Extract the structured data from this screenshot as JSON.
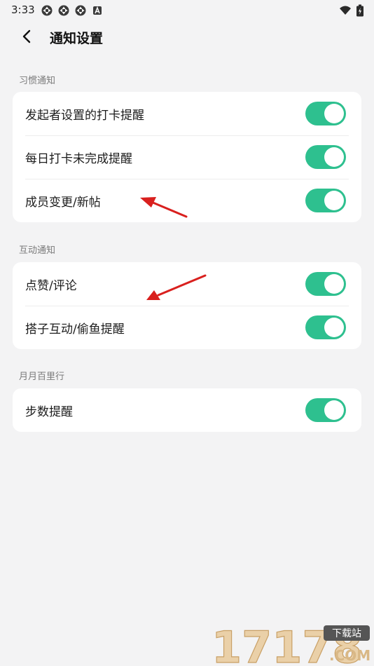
{
  "status_bar": {
    "time": "3:33",
    "icons": [
      "sync-icon",
      "sync-icon",
      "sync-icon",
      "a-badge-icon",
      "wifi-icon",
      "battery-icon"
    ]
  },
  "header": {
    "title": "通知设置",
    "back_icon": "chevron-left-icon"
  },
  "sections": [
    {
      "label": "习惯通知",
      "items": [
        {
          "label": "发起者设置的打卡提醒",
          "enabled": true
        },
        {
          "label": "每日打卡未完成提醒",
          "enabled": true
        },
        {
          "label": "成员变更/新帖",
          "enabled": true
        }
      ]
    },
    {
      "label": "互动通知",
      "items": [
        {
          "label": "点赞/评论",
          "enabled": true
        },
        {
          "label": "搭子互动/偷鱼提醒",
          "enabled": true
        }
      ]
    },
    {
      "label": "月月百里行",
      "items": [
        {
          "label": "步数提醒",
          "enabled": true
        }
      ]
    }
  ],
  "colors": {
    "toggle_on": "#2ec08f",
    "background": "#f3f3f4",
    "card": "#ffffff",
    "annotation_arrow": "#d9201e"
  },
  "watermark": {
    "brand": "17178",
    "badge": "下载站",
    "domain": ".COM"
  }
}
